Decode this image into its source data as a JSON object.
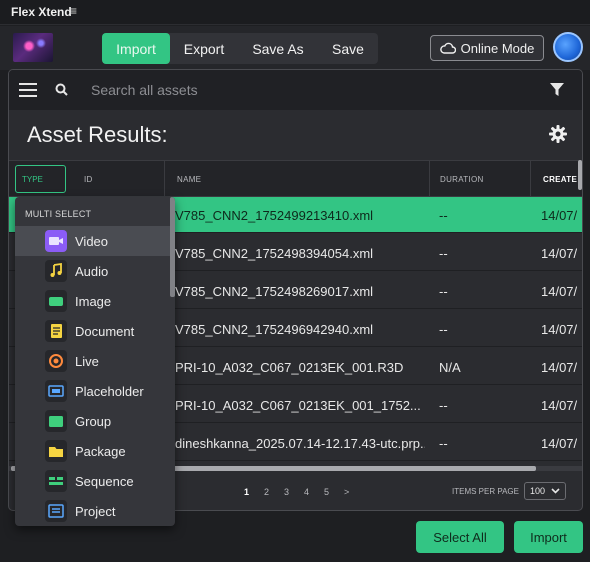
{
  "app": {
    "title": "Flex Xtend",
    "menu_icon": "≡"
  },
  "toolbar": {
    "import": "Import",
    "export": "Export",
    "save_as": "Save As",
    "save": "Save",
    "online_mode": "Online Mode"
  },
  "search": {
    "placeholder": "Search all assets"
  },
  "results": {
    "title": "Asset Results:"
  },
  "columns": {
    "type": "TYPE",
    "id": "ID",
    "name": "NAME",
    "duration": "DURATION",
    "created": "CREATE"
  },
  "rows": [
    {
      "name": "V785_CNN2_1752499213410.xml",
      "duration": "--",
      "created": "14/07/"
    },
    {
      "name": "V785_CNN2_1752498394054.xml",
      "duration": "--",
      "created": "14/07/"
    },
    {
      "name": "V785_CNN2_1752498269017.xml",
      "duration": "--",
      "created": "14/07/"
    },
    {
      "name": "V785_CNN2_1752496942940.xml",
      "duration": "--",
      "created": "14/07/"
    },
    {
      "name": "PRI-10_A032_C067_0213EK_001.R3D",
      "duration": "N/A",
      "created": "14/07/"
    },
    {
      "name": "PRI-10_A032_C067_0213EK_001_1752...",
      "duration": "--",
      "created": "14/07/"
    },
    {
      "name": "dineshkanna_2025.07.14-12.17.43-utc.prp...",
      "duration": "--",
      "created": "14/07/"
    }
  ],
  "dropdown": {
    "header": "MULTI SELECT",
    "items": [
      "Video",
      "Audio",
      "Image",
      "Document",
      "Live",
      "Placeholder",
      "Group",
      "Package",
      "Sequence",
      "Project"
    ]
  },
  "pagination": {
    "pages": [
      "1",
      "2",
      "3",
      "4",
      "5"
    ],
    "next": ">",
    "items_per_page_label": "ITEMS PER PAGE",
    "items_per_page": "100"
  },
  "footer": {
    "select_all": "Select All",
    "import": "Import"
  },
  "colors": {
    "accent": "#33c584",
    "panel": "#2b2c30",
    "background": "#1e1f22"
  }
}
